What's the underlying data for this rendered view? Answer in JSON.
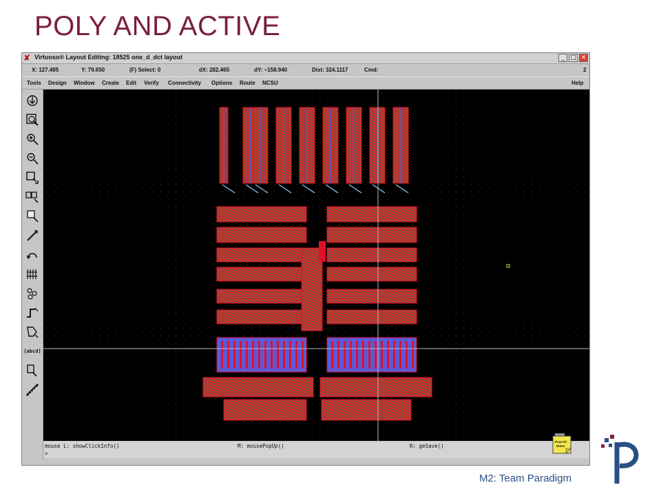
{
  "slide": {
    "title": "POLY AND ACTIVE",
    "footer": "M2: Team Paradigm"
  },
  "window": {
    "title": "Virtuoso® Layout Editing: 18525 one_d_dct layout",
    "close_glyph": "✘",
    "min_glyph": "_",
    "max_glyph": "□",
    "x_glyph": "✕"
  },
  "status": {
    "x": "X: 127.485",
    "y": "Y: 79.650",
    "select": "(F) Select: 0",
    "dx": "dX: 282.465",
    "dy": "dY: −158.940",
    "dist": "Dist: 324.1117",
    "cmd": "Cmd:",
    "num": "2"
  },
  "menu": {
    "items": [
      "Tools",
      "Design",
      "Window",
      "Create",
      "Edit",
      "Verify",
      "Connectivity",
      "Options",
      "Route",
      "NCSU"
    ],
    "help": "Help"
  },
  "toolbar": {
    "tools": [
      "save-icon",
      "fit-icon",
      "zoom-in-icon",
      "zoom-out-icon",
      "stretch-icon",
      "copy-icon",
      "move-icon",
      "delete-icon",
      "undo-icon",
      "property-icon",
      "instance-icon",
      "path-icon",
      "polygon-icon",
      "label-icon",
      "rectangle-icon",
      "ruler-icon"
    ],
    "label_tool_text": "[abcd]"
  },
  "cmd": {
    "mouse_left": "mouse L: showClickInfo()",
    "mouse_middle": "M: mousePopUp()",
    "mouse_right": "R: geSave()",
    "prompt": ">"
  },
  "postit": {
    "line1": "Post-it®",
    "line2": "Notes"
  },
  "colors": {
    "title": "#7a1f3c",
    "footer": "#2a4f86",
    "canvas": "#000000",
    "poly": "#e0102a",
    "active": "#2ea84a",
    "metal": "#5a5ad8"
  }
}
